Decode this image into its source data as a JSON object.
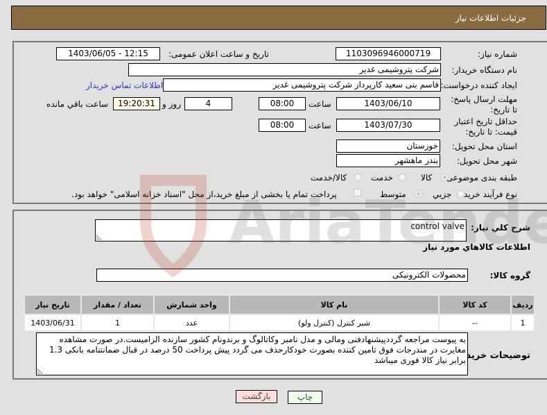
{
  "header": {
    "title": "جزئیات اطلاعات نیاز"
  },
  "form": {
    "need_number": {
      "label": "شماره نیاز:",
      "value": "1103096946000719"
    },
    "announce_datetime": {
      "label": "تاریخ و ساعت اعلان عمومی:",
      "value": "1403/06/05 - 12:15"
    },
    "buyer_org": {
      "label": "نام دستگاه خریدار:",
      "value": "شرکت پتروشیمی غدیر"
    },
    "requester": {
      "label": "ایجاد کننده درخواست:",
      "value": "قاسم بنی سعید کارپرداز شرکت پتروشیمی غدیر"
    },
    "buyer_contact_link": "اطلاعات تماس خریدار",
    "reply_deadline": {
      "label": "مهلت ارسال پاسخ: تا تاریخ:",
      "date": "1403/06/10",
      "time_label": "ساعت",
      "time": "08:00",
      "days": "4",
      "days_label": "روز و",
      "remaining_time": "19:20:31",
      "remaining_label": "ساعت باقي مانده"
    },
    "price_validity": {
      "label": "حداقل تاریخ اعتبار قیمت: تا تاریخ:",
      "date": "1403/07/30",
      "time_label": "ساعت",
      "time": "08:00"
    },
    "delivery_province": {
      "label": "استان محل تحویل:",
      "value": "خوزستان"
    },
    "delivery_city": {
      "label": "شهر محل تحویل:",
      "value": "بندر ماهشهر"
    },
    "category": {
      "label": "طبقه بندی موضوعی:",
      "options": [
        "کالا",
        "خدمت",
        "کالا/خدمت"
      ],
      "selected": "کالا"
    },
    "purchase_type": {
      "label": "نوع فرآیند خرید :",
      "options": [
        "جزیي",
        "متوسط"
      ],
      "selected": "متوسط",
      "treasury_checkbox_label": "پرداخت تمام یا بخشی از مبلغ خرید،از محل \"اسناد خزانه اسلامی\" خواهد بود.",
      "treasury_checked": false
    }
  },
  "details": {
    "description_label": "شرح کلي نياز:",
    "description_value": "control valve",
    "goods_info_title": "اطلاعات کالاهاي مورد نياز",
    "goods_group_label": "گروه کالا:",
    "goods_group_value": "محصولات الکترونیکی",
    "table": {
      "headers": [
        "رديف",
        "کد کالا",
        "نام کالا",
        "واحد شمارش",
        "تعداد / مقدار",
        "تاریخ نیاز"
      ],
      "rows": [
        [
          "1",
          "--",
          "شیر کنترل (کنترل ولو)",
          "عدد",
          "1",
          "1403/06/31"
        ]
      ]
    },
    "buyer_notes_label": "توضیحات خریدار:",
    "buyer_notes_value": "به پیوست مراجعه گرددپیشنهادفنی ومالی و مدل نامبر وکاتالوگ و برندونام کشور سازنده الزامیست.در صورت مشاهده مغایرت در مندرجات فوق تامین کننده بصورت خودکارحذف می گردد پیش پرداخت 50 درصد در قبال ضمانتنامه بانکی 1.3 برابر نیاز کالا فوری میباشد"
  },
  "buttons": {
    "print": "چاپ",
    "back": "بازگشت"
  },
  "watermark": {
    "text": "AriaTender.net"
  },
  "colors": {
    "header_bg": "#8b6b41",
    "print_bg": "#eeffee",
    "back_bg": "#ffdede",
    "link": "#3333cc"
  }
}
